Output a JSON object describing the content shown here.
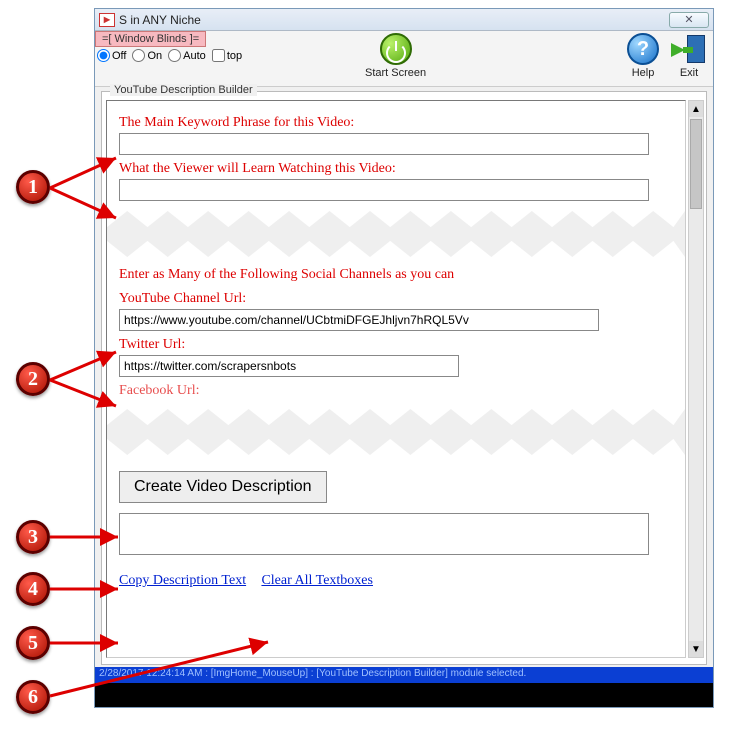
{
  "window": {
    "title": "S in ANY Niche",
    "blinds_label": "=[ Window Blinds ]=",
    "radios": {
      "off": "Off",
      "on": "On",
      "auto": "Auto",
      "top": "top"
    }
  },
  "toolbar": {
    "start": "Start Screen",
    "help": "Help",
    "exit": "Exit"
  },
  "group": {
    "title": "YouTube Description Builder",
    "label_keyword": "The Main Keyword Phrase for this Video:",
    "label_learn": "What the Viewer will Learn Watching this Video:",
    "label_social_intro": "Enter as Many of the Following Social Channels as you can",
    "label_youtube": "YouTube Channel Url:",
    "value_youtube": "https://www.youtube.com/channel/UCbtmiDFGEJhljvn7hRQL5Vv",
    "label_twitter": "Twitter Url:",
    "value_twitter": "https://twitter.com/scrapersnbots",
    "label_facebook": "Facebook Url:",
    "create_button": "Create Video Description",
    "link_copy": "Copy Description Text",
    "link_clear": "Clear All Textboxes"
  },
  "status": "2/28/2017 12:24:14 AM : [ImgHome_MouseUp] : [YouTube Description Builder] module selected.",
  "badges": {
    "b1": "1",
    "b2": "2",
    "b3": "3",
    "b4": "4",
    "b5": "5",
    "b6": "6"
  },
  "help_glyph": "?",
  "scroll_up": "▲",
  "scroll_down": "▼",
  "close_glyph": "✕"
}
